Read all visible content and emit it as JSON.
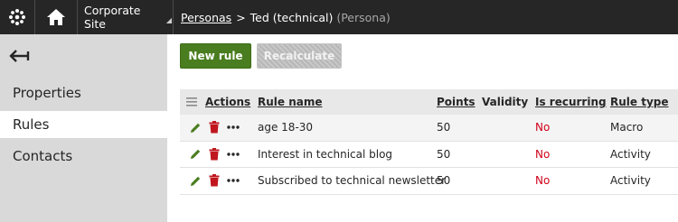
{
  "topbar": {
    "site_label": "Corporate Site",
    "breadcrumb": {
      "link": "Personas",
      "separator": ">",
      "current": "Ted (technical)",
      "current_suffix": "(Persona)"
    }
  },
  "sidebar": {
    "items": [
      {
        "label": "Properties",
        "active": false
      },
      {
        "label": "Rules",
        "active": true
      },
      {
        "label": "Contacts",
        "active": false
      }
    ]
  },
  "toolbar": {
    "new_rule_label": "New rule",
    "recalculate_label": "Recalculate"
  },
  "table": {
    "headers": {
      "actions": "Actions",
      "rule_name": "Rule name",
      "points": "Points",
      "validity": "Validity",
      "is_recurring": "Is recurring",
      "rule_type": "Rule type"
    },
    "rows": [
      {
        "rule_name": "age 18-30",
        "points": "50",
        "validity": "",
        "is_recurring": "No",
        "rule_type": "Macro"
      },
      {
        "rule_name": "Interest in technical blog",
        "points": "50",
        "validity": "",
        "is_recurring": "No",
        "rule_type": "Activity"
      },
      {
        "rule_name": "Subscribed to technical newsletter",
        "points": "50",
        "validity": "",
        "is_recurring": "No",
        "rule_type": "Activity"
      }
    ]
  },
  "colors": {
    "topbar_bg": "#262626",
    "sidebar_bg": "#d9d9d9",
    "primary_button": "#497d1f",
    "edit_icon": "#497d1f",
    "delete_icon": "#c0171f",
    "no_text": "#d0021b"
  },
  "icons": {
    "logo": "kentico-logo-icon",
    "home": "home-icon",
    "back": "arrow-left-icon",
    "column_menu": "column-menu-icon",
    "edit": "pencil-icon",
    "delete": "trash-icon",
    "more": "more-dots-icon"
  }
}
